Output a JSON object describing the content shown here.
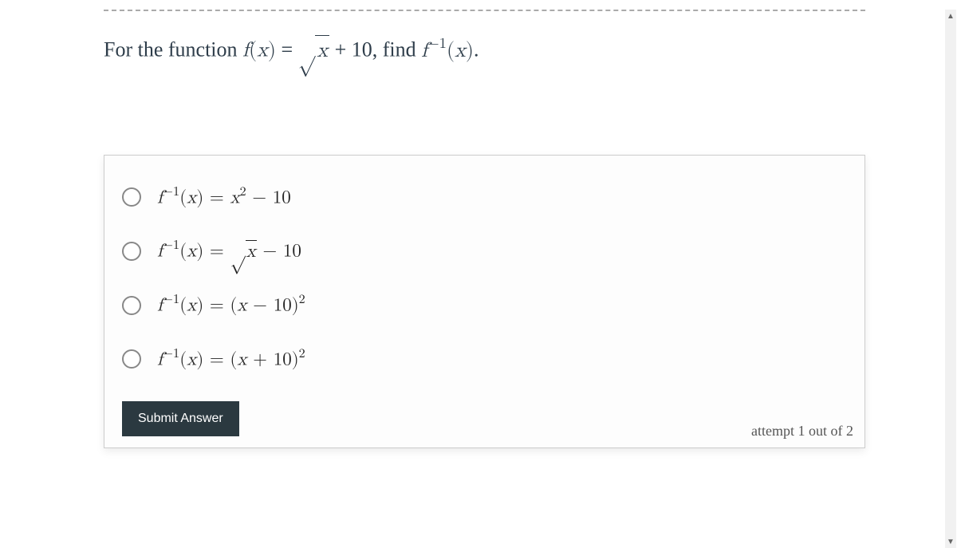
{
  "question": {
    "prefix": "For the function ",
    "fn_name": "f",
    "fn_arg": "x",
    "equals": " = ",
    "sqrt_arg": "x",
    "plus": " + 10",
    "find": ", find ",
    "inverse_exp": "−1",
    "period": "."
  },
  "options": [
    {
      "lhs_f": "f",
      "lhs_exp": "−1",
      "lhs_arg": "x",
      "rhs": "x² − 10",
      "type": "plain"
    },
    {
      "lhs_f": "f",
      "lhs_exp": "−1",
      "lhs_arg": "x",
      "rhs_sqrt": "x",
      "rhs_tail": " − 10",
      "type": "sqrt"
    },
    {
      "lhs_f": "f",
      "lhs_exp": "−1",
      "lhs_arg": "x",
      "rhs_base": "(x − 10)",
      "rhs_exp": "2",
      "type": "power"
    },
    {
      "lhs_f": "f",
      "lhs_exp": "−1",
      "lhs_arg": "x",
      "rhs_base": "(x + 10)",
      "rhs_exp": "2",
      "type": "power"
    }
  ],
  "submit_label": "Submit Answer",
  "attempt_text": "attempt 1 out of 2"
}
